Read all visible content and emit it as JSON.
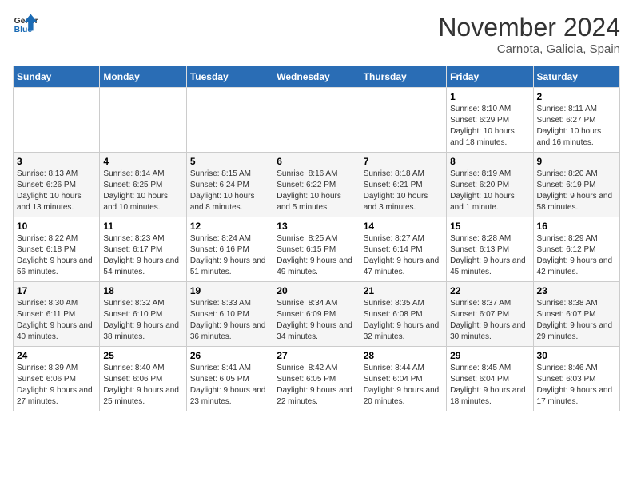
{
  "header": {
    "logo_line1": "General",
    "logo_line2": "Blue",
    "month": "November 2024",
    "location": "Carnota, Galicia, Spain"
  },
  "days_of_week": [
    "Sunday",
    "Monday",
    "Tuesday",
    "Wednesday",
    "Thursday",
    "Friday",
    "Saturday"
  ],
  "weeks": [
    [
      {
        "day": "",
        "info": ""
      },
      {
        "day": "",
        "info": ""
      },
      {
        "day": "",
        "info": ""
      },
      {
        "day": "",
        "info": ""
      },
      {
        "day": "",
        "info": ""
      },
      {
        "day": "1",
        "info": "Sunrise: 8:10 AM\nSunset: 6:29 PM\nDaylight: 10 hours and 18 minutes."
      },
      {
        "day": "2",
        "info": "Sunrise: 8:11 AM\nSunset: 6:27 PM\nDaylight: 10 hours and 16 minutes."
      }
    ],
    [
      {
        "day": "3",
        "info": "Sunrise: 8:13 AM\nSunset: 6:26 PM\nDaylight: 10 hours and 13 minutes."
      },
      {
        "day": "4",
        "info": "Sunrise: 8:14 AM\nSunset: 6:25 PM\nDaylight: 10 hours and 10 minutes."
      },
      {
        "day": "5",
        "info": "Sunrise: 8:15 AM\nSunset: 6:24 PM\nDaylight: 10 hours and 8 minutes."
      },
      {
        "day": "6",
        "info": "Sunrise: 8:16 AM\nSunset: 6:22 PM\nDaylight: 10 hours and 5 minutes."
      },
      {
        "day": "7",
        "info": "Sunrise: 8:18 AM\nSunset: 6:21 PM\nDaylight: 10 hours and 3 minutes."
      },
      {
        "day": "8",
        "info": "Sunrise: 8:19 AM\nSunset: 6:20 PM\nDaylight: 10 hours and 1 minute."
      },
      {
        "day": "9",
        "info": "Sunrise: 8:20 AM\nSunset: 6:19 PM\nDaylight: 9 hours and 58 minutes."
      }
    ],
    [
      {
        "day": "10",
        "info": "Sunrise: 8:22 AM\nSunset: 6:18 PM\nDaylight: 9 hours and 56 minutes."
      },
      {
        "day": "11",
        "info": "Sunrise: 8:23 AM\nSunset: 6:17 PM\nDaylight: 9 hours and 54 minutes."
      },
      {
        "day": "12",
        "info": "Sunrise: 8:24 AM\nSunset: 6:16 PM\nDaylight: 9 hours and 51 minutes."
      },
      {
        "day": "13",
        "info": "Sunrise: 8:25 AM\nSunset: 6:15 PM\nDaylight: 9 hours and 49 minutes."
      },
      {
        "day": "14",
        "info": "Sunrise: 8:27 AM\nSunset: 6:14 PM\nDaylight: 9 hours and 47 minutes."
      },
      {
        "day": "15",
        "info": "Sunrise: 8:28 AM\nSunset: 6:13 PM\nDaylight: 9 hours and 45 minutes."
      },
      {
        "day": "16",
        "info": "Sunrise: 8:29 AM\nSunset: 6:12 PM\nDaylight: 9 hours and 42 minutes."
      }
    ],
    [
      {
        "day": "17",
        "info": "Sunrise: 8:30 AM\nSunset: 6:11 PM\nDaylight: 9 hours and 40 minutes."
      },
      {
        "day": "18",
        "info": "Sunrise: 8:32 AM\nSunset: 6:10 PM\nDaylight: 9 hours and 38 minutes."
      },
      {
        "day": "19",
        "info": "Sunrise: 8:33 AM\nSunset: 6:10 PM\nDaylight: 9 hours and 36 minutes."
      },
      {
        "day": "20",
        "info": "Sunrise: 8:34 AM\nSunset: 6:09 PM\nDaylight: 9 hours and 34 minutes."
      },
      {
        "day": "21",
        "info": "Sunrise: 8:35 AM\nSunset: 6:08 PM\nDaylight: 9 hours and 32 minutes."
      },
      {
        "day": "22",
        "info": "Sunrise: 8:37 AM\nSunset: 6:07 PM\nDaylight: 9 hours and 30 minutes."
      },
      {
        "day": "23",
        "info": "Sunrise: 8:38 AM\nSunset: 6:07 PM\nDaylight: 9 hours and 29 minutes."
      }
    ],
    [
      {
        "day": "24",
        "info": "Sunrise: 8:39 AM\nSunset: 6:06 PM\nDaylight: 9 hours and 27 minutes."
      },
      {
        "day": "25",
        "info": "Sunrise: 8:40 AM\nSunset: 6:06 PM\nDaylight: 9 hours and 25 minutes."
      },
      {
        "day": "26",
        "info": "Sunrise: 8:41 AM\nSunset: 6:05 PM\nDaylight: 9 hours and 23 minutes."
      },
      {
        "day": "27",
        "info": "Sunrise: 8:42 AM\nSunset: 6:05 PM\nDaylight: 9 hours and 22 minutes."
      },
      {
        "day": "28",
        "info": "Sunrise: 8:44 AM\nSunset: 6:04 PM\nDaylight: 9 hours and 20 minutes."
      },
      {
        "day": "29",
        "info": "Sunrise: 8:45 AM\nSunset: 6:04 PM\nDaylight: 9 hours and 18 minutes."
      },
      {
        "day": "30",
        "info": "Sunrise: 8:46 AM\nSunset: 6:03 PM\nDaylight: 9 hours and 17 minutes."
      }
    ]
  ]
}
